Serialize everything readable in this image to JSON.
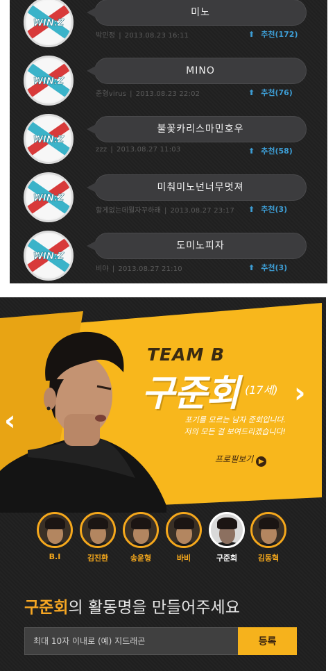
{
  "comments": [
    {
      "text": "미노",
      "author": "박민정",
      "date": "2013.08.23 16:11",
      "recommend": "추천(172)"
    },
    {
      "text": "MINO",
      "author": "준형virus",
      "date": "2013.08.23 22:02",
      "recommend": "추천(76)"
    },
    {
      "text": "불꽃카리스마민호우",
      "author": "zzz",
      "date": "2013.08.27 11:03",
      "recommend": "추천(58)"
    },
    {
      "text": "미춰미노넌너무멋져",
      "author": "할게없는데뭘자꾸하래",
      "date": "2013.08.27 23:17",
      "recommend": "추천(3)"
    },
    {
      "text": "도미노피자",
      "author": "비야",
      "date": "2013.08.27 21:10",
      "recommend": "추천(3)"
    }
  ],
  "avatar_badge_text": "WIN:Z",
  "banner": {
    "team": "TEAM B",
    "member": "구준회",
    "age": "(17세)",
    "tagline_line1": "포기를 모르는 남자 준회입니다.",
    "tagline_line2": "저의 모든 걸 보여드리겠습니다!",
    "profile_link": "프로필보기",
    "prev_arrow": "‹",
    "next_arrow": "›"
  },
  "members": [
    {
      "name": "B.I",
      "active": false
    },
    {
      "name": "김진환",
      "active": false
    },
    {
      "name": "송윤형",
      "active": false
    },
    {
      "name": "바비",
      "active": false
    },
    {
      "name": "구준회",
      "active": true
    },
    {
      "name": "김동혁",
      "active": false
    }
  ],
  "form": {
    "headline_name": "구준회",
    "headline_rest": "의 활동명을 만들어주세요",
    "placeholder": "최대 10자 이내로 (예) 지드래곤",
    "submit_label": "등록"
  },
  "colors": {
    "accent": "#f6b21c",
    "recommend": "#3d9dd4",
    "panel_bg": "#202020"
  },
  "icons": [
    "up-arrow-icon",
    "chevron-left-icon",
    "chevron-right-icon",
    "play-circle-icon"
  ]
}
